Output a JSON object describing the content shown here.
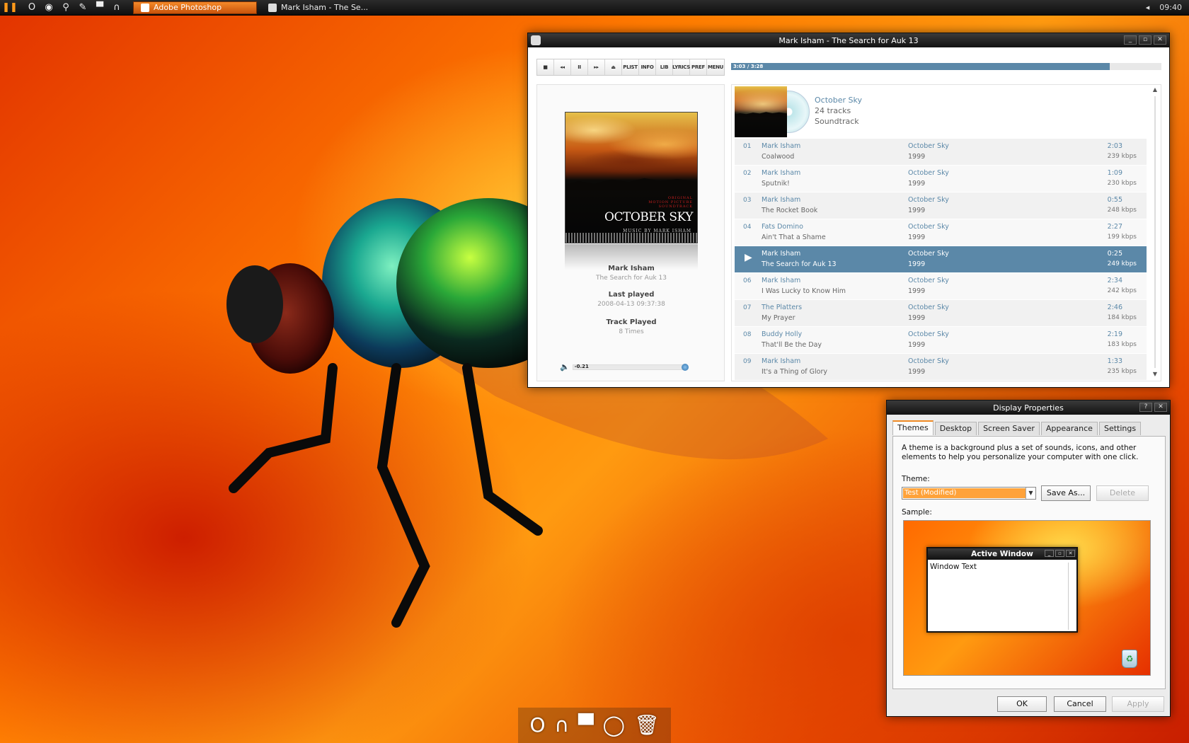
{
  "taskbar": {
    "quick_icons": [
      "O",
      "◉",
      "⚲",
      "✎",
      "▀",
      "∩"
    ],
    "tasks": [
      {
        "label": "Adobe Photoshop",
        "active": true
      },
      {
        "label": "Mark Isham - The Se...",
        "active": false
      }
    ],
    "tray_arrow": "◂",
    "clock": "09:40"
  },
  "player": {
    "title": "Mark Isham - The Search for Auk 13",
    "controls": [
      "■",
      "◂◂",
      "II",
      "▸▸",
      "⏏",
      "PLIST",
      "INFO",
      "LIB",
      "LYRICS",
      "PREF",
      "MENU"
    ],
    "progress_text": "3:03 / 3:28",
    "progress_fraction": 0.88,
    "now_playing": {
      "artist": "Mark Isham",
      "title": "The Search for Auk 13",
      "last_played_label": "Last played",
      "last_played": "2008-04-13 09:37:38",
      "track_played_label": "Track Played",
      "track_played": "8 Times"
    },
    "volume_text": "-0.21",
    "cover_text": {
      "l1": "ORIGINAL",
      "l2": "MOTION PICTURE",
      "l3": "SOUNDTRACK",
      "title": "OCTOBER SKY",
      "by": "MUSIC BY MARK ISHAM"
    },
    "album": {
      "name": "October Sky",
      "tracks": "24 tracks",
      "genre": "Soundtrack"
    },
    "rows": [
      {
        "num": "01",
        "artist": "Mark Isham",
        "title": "Coalwood",
        "album": "October Sky",
        "year": "1999",
        "dur": "2:03",
        "kbps": "239 kbps"
      },
      {
        "num": "02",
        "artist": "Mark Isham",
        "title": "Sputnik!",
        "album": "October Sky",
        "year": "1999",
        "dur": "1:09",
        "kbps": "230 kbps"
      },
      {
        "num": "03",
        "artist": "Mark Isham",
        "title": "The Rocket Book",
        "album": "October Sky",
        "year": "1999",
        "dur": "0:55",
        "kbps": "248 kbps"
      },
      {
        "num": "04",
        "artist": "Fats Domino",
        "title": "Ain't That a Shame",
        "album": "October Sky",
        "year": "1999",
        "dur": "2:27",
        "kbps": "199 kbps"
      },
      {
        "num": "▶",
        "artist": "Mark Isham",
        "title": "The Search for Auk 13",
        "album": "October Sky",
        "year": "1999",
        "dur": "0:25",
        "kbps": "249 kbps"
      },
      {
        "num": "06",
        "artist": "Mark Isham",
        "title": "I Was Lucky to Know Him",
        "album": "October Sky",
        "year": "1999",
        "dur": "2:34",
        "kbps": "242 kbps"
      },
      {
        "num": "07",
        "artist": "The Platters",
        "title": "My Prayer",
        "album": "October Sky",
        "year": "1999",
        "dur": "2:46",
        "kbps": "184 kbps"
      },
      {
        "num": "08",
        "artist": "Buddy Holly",
        "title": "That'll Be the Day",
        "album": "October Sky",
        "year": "1999",
        "dur": "2:19",
        "kbps": "183 kbps"
      },
      {
        "num": "09",
        "artist": "Mark Isham",
        "title": "It's a Thing of Glory",
        "album": "October Sky",
        "year": "1999",
        "dur": "1:33",
        "kbps": "235 kbps"
      }
    ],
    "playing_index": 4
  },
  "display_properties": {
    "title": "Display Properties",
    "title_buttons": [
      "?",
      "✕"
    ],
    "tabs": [
      "Themes",
      "Desktop",
      "Screen Saver",
      "Appearance",
      "Settings"
    ],
    "selected_tab": 0,
    "description": "A theme is a background plus a set of sounds, icons, and other elements to help you personalize your computer with one click.",
    "theme_label": "Theme:",
    "theme_value": "Test (Modified)",
    "save_as": "Save As...",
    "delete": "Delete",
    "sample_label": "Sample:",
    "sample_window_title": "Active Window",
    "sample_window_text": "Window Text",
    "ok": "OK",
    "cancel": "Cancel",
    "apply": "Apply"
  },
  "window_buttons": [
    "_",
    "▫",
    "✕"
  ],
  "dock": [
    "O",
    "∩",
    "▀",
    "◯",
    "🗑"
  ]
}
